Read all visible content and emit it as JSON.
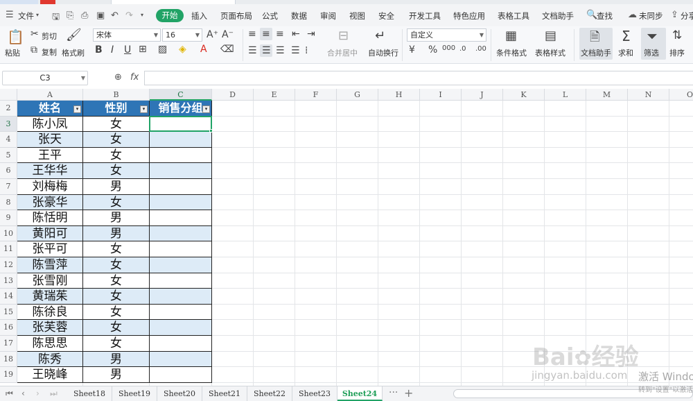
{
  "menu": {
    "file": "文件",
    "tabs": [
      "开始",
      "插入",
      "页面布局",
      "公式",
      "数据",
      "审阅",
      "视图",
      "安全",
      "开发工具",
      "特色应用",
      "表格工具",
      "文档助手"
    ],
    "search": "查找",
    "sync": "未同步",
    "share": "分享"
  },
  "ribbon": {
    "paste": "粘贴",
    "cut": "剪切",
    "copy": "复制",
    "format_painter": "格式刷",
    "font_name": "宋体",
    "font_size": "16",
    "merge_center": "合并居中",
    "wrap_text": "自动换行",
    "number_format": "自定义",
    "conditional_format": "条件格式",
    "table_style": "表格样式",
    "doc_assistant": "文档助手",
    "sum": "求和",
    "filter": "筛选",
    "sort": "排序"
  },
  "formula_bar": {
    "name_box": "C3",
    "fx": "fx",
    "value": ""
  },
  "sheet": {
    "columns": [
      "A",
      "B",
      "C",
      "D",
      "E",
      "F",
      "G",
      "H",
      "I",
      "J",
      "K",
      "L",
      "M",
      "N",
      "O"
    ],
    "row_numbers": [
      "2",
      "3",
      "4",
      "5",
      "6",
      "7",
      "8",
      "9",
      "10",
      "11",
      "12",
      "13",
      "14",
      "15",
      "16",
      "17",
      "18",
      "19"
    ],
    "headers": [
      "姓名",
      "性别",
      "销售分组"
    ],
    "rows": [
      [
        "陈小凤",
        "女",
        ""
      ],
      [
        "张天",
        "女",
        ""
      ],
      [
        "王平",
        "女",
        ""
      ],
      [
        "王华华",
        "女",
        ""
      ],
      [
        "刘梅梅",
        "男",
        ""
      ],
      [
        "张豪华",
        "女",
        ""
      ],
      [
        "陈恬明",
        "男",
        ""
      ],
      [
        "黄阳可",
        "男",
        ""
      ],
      [
        "张平可",
        "女",
        ""
      ],
      [
        "陈雪萍",
        "女",
        ""
      ],
      [
        "张雪刚",
        "女",
        ""
      ],
      [
        "黄瑞茱",
        "女",
        ""
      ],
      [
        "陈徐良",
        "女",
        ""
      ],
      [
        "张芙蓉",
        "女",
        ""
      ],
      [
        "陈思思",
        "女",
        ""
      ],
      [
        "陈秀",
        "男",
        ""
      ],
      [
        "王晓峰",
        "男",
        ""
      ]
    ],
    "header_color": "#2e75b6",
    "band_color": "#ddebf7"
  },
  "tabs": {
    "sheets": [
      "Sheet18",
      "Sheet19",
      "Sheet20",
      "Sheet21",
      "Sheet22",
      "Sheet23",
      "Sheet24"
    ],
    "active": "Sheet24",
    "more": "···",
    "add": "+"
  },
  "watermark": {
    "brand": "Bai",
    "brand2": "经验",
    "url": "jingyan.baidu.com",
    "activate": "激活 Windows",
    "activate_hint": "转到\"设置\"以激活"
  }
}
